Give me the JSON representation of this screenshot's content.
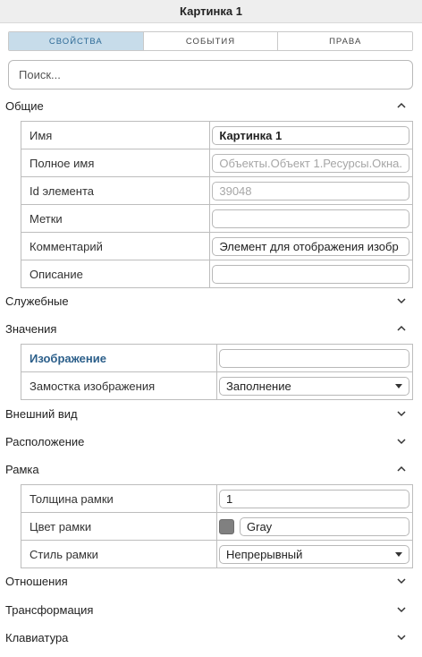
{
  "window": {
    "title": "Картинка 1"
  },
  "tabs": [
    {
      "label": "СВОЙСТВА",
      "active": true
    },
    {
      "label": "СОБЫТИЯ",
      "active": false
    },
    {
      "label": "ПРАВА",
      "active": false
    }
  ],
  "search": {
    "placeholder": "Поиск..."
  },
  "sections": {
    "general": {
      "title": "Общие",
      "expanded": true,
      "rows": {
        "name": {
          "label": "Имя",
          "value": "Картинка 1"
        },
        "full_name": {
          "label": "Полное имя",
          "value": "Объекты.Объект 1.Ресурсы.Окна."
        },
        "element_id": {
          "label": "Id элемента",
          "value": "39048"
        },
        "tags": {
          "label": "Метки",
          "value": ""
        },
        "comment": {
          "label": "Комментарий",
          "value": "Элемент для отображения изобр"
        },
        "description": {
          "label": "Описание",
          "value": ""
        }
      }
    },
    "service": {
      "title": "Служебные",
      "expanded": false
    },
    "values": {
      "title": "Значения",
      "expanded": true,
      "rows": {
        "image": {
          "label": "Изображение",
          "value": ""
        },
        "tiling": {
          "label": "Замостка изображения",
          "value": "Заполнение"
        }
      }
    },
    "appearance": {
      "title": "Внешний вид",
      "expanded": false
    },
    "layout": {
      "title": "Расположение",
      "expanded": false
    },
    "frame": {
      "title": "Рамка",
      "expanded": true,
      "rows": {
        "thickness": {
          "label": "Толщина рамки",
          "value": "1"
        },
        "color": {
          "label": "Цвет рамки",
          "value": "Gray",
          "swatch": "#808080"
        },
        "style": {
          "label": "Стиль рамки",
          "value": "Непрерывный"
        }
      }
    },
    "relations": {
      "title": "Отношения",
      "expanded": false
    },
    "transform": {
      "title": "Трансформация",
      "expanded": false
    },
    "keyboard": {
      "title": "Клавиатура",
      "expanded": false
    }
  },
  "colors": {
    "accent": "#2d6a96",
    "active_tab_bg": "#c7dcea",
    "header_bg": "#eeeeee"
  },
  "icons": {
    "expanded": "chevron-up-icon",
    "collapsed": "chevron-down-icon"
  }
}
